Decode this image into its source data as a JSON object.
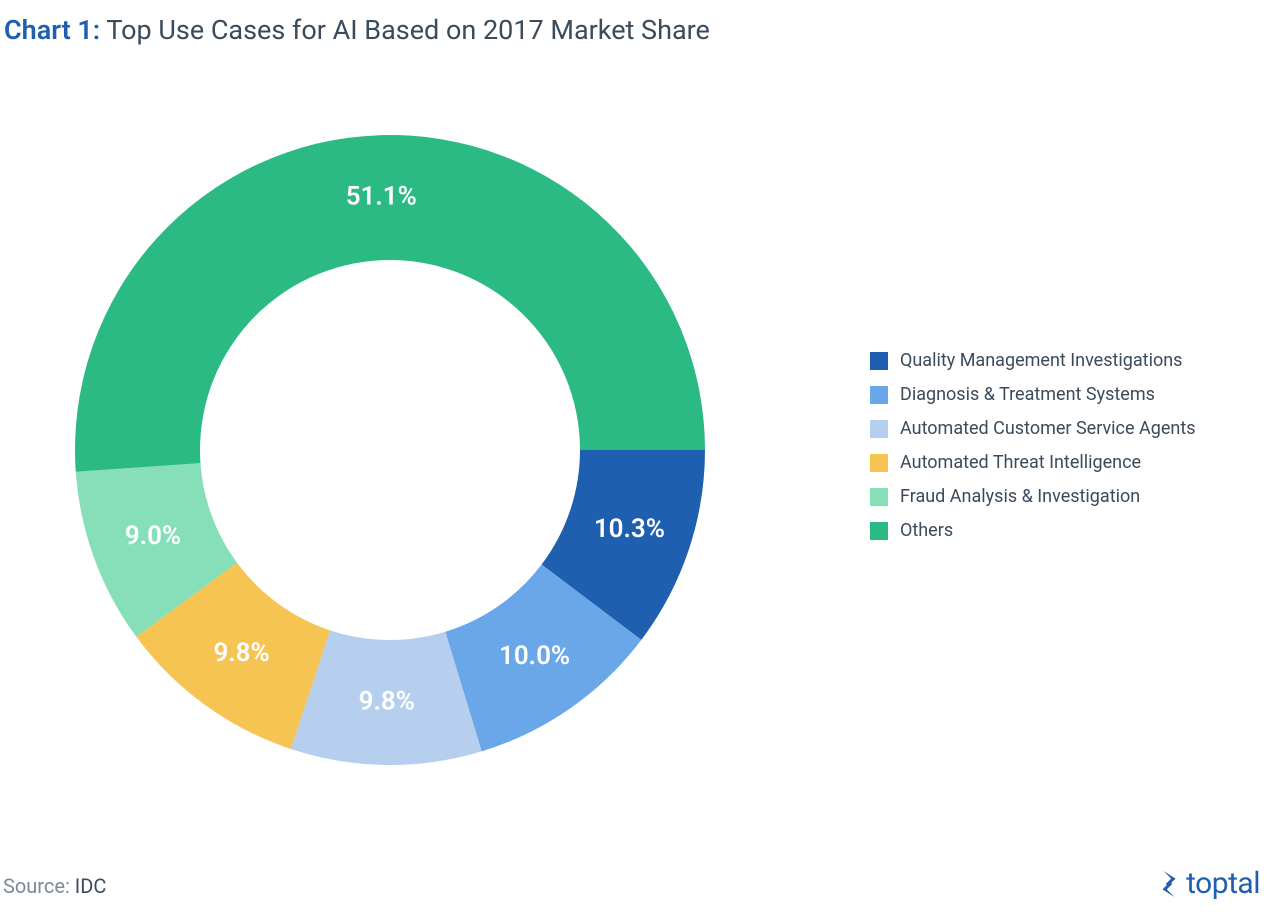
{
  "header": {
    "chart_number": "Chart 1:",
    "title": "Top Use Cases for AI Based on 2017 Market Share"
  },
  "source": {
    "label": "Source:",
    "value": "IDC"
  },
  "brand": {
    "name": "toptal"
  },
  "chart_data": {
    "type": "pie",
    "title": "Top Use Cases for AI Based on 2017 Market Share",
    "donut": true,
    "start_angle_deg": 90,
    "series": [
      {
        "name": "Quality Management Investigations",
        "value": 10.3,
        "label": "10.3%",
        "color": "#1f5fb0"
      },
      {
        "name": "Diagnosis & Treatment Systems",
        "value": 10.0,
        "label": "10.0%",
        "color": "#6aa7e8"
      },
      {
        "name": "Automated Customer Service Agents",
        "value": 9.8,
        "label": "9.8%",
        "color": "#b7cfef"
      },
      {
        "name": "Automated Threat Intelligence",
        "value": 9.8,
        "label": "9.8%",
        "color": "#f5c453"
      },
      {
        "name": "Fraud Analysis & Investigation",
        "value": 9.0,
        "label": "9.0%",
        "color": "#86dfb9"
      },
      {
        "name": "Others",
        "value": 51.1,
        "label": "51.1%",
        "color": "#2bba84"
      }
    ]
  }
}
